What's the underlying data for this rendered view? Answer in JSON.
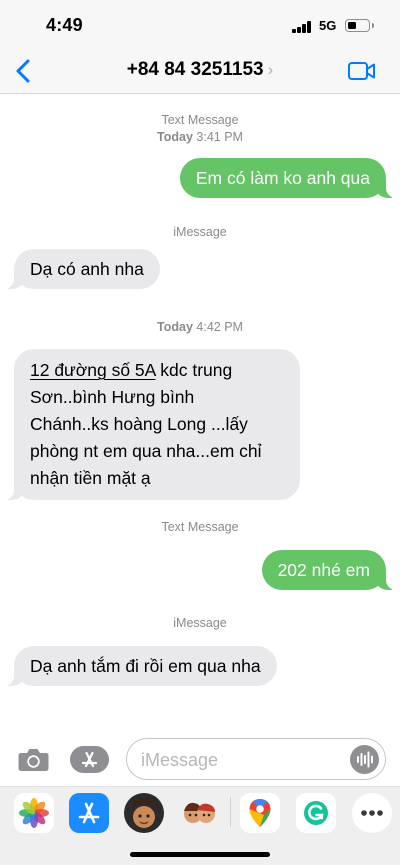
{
  "status_bar": {
    "time": "4:49",
    "network": "5G"
  },
  "header": {
    "contact": "+84 84 3251153",
    "chevron": "›"
  },
  "messages": [
    {
      "type": "meta",
      "service": "Text Message",
      "day": "Today",
      "time": "3:41 PM"
    },
    {
      "type": "outgoing",
      "text": "Em có làm ko anh qua"
    },
    {
      "type": "meta",
      "service": "iMessage"
    },
    {
      "type": "incoming",
      "text": "Dạ có anh nha"
    },
    {
      "type": "meta",
      "day": "Today",
      "time": "4:42 PM"
    },
    {
      "type": "incoming",
      "lines": [
        "12 đường số 5A",
        " kdc trung",
        "Sơn..bình Hưng bình",
        "Chánh..ks hoàng Long ...lấy",
        "phòng nt em qua nha...em chỉ",
        "nhận tiền mặt ạ"
      ]
    },
    {
      "type": "meta",
      "service": "Text Message"
    },
    {
      "type": "outgoing",
      "text": "202 nhé em"
    },
    {
      "type": "meta",
      "service": "iMessage"
    },
    {
      "type": "incoming",
      "text": "Dạ anh tắm đi rồi em qua nha"
    }
  ],
  "input": {
    "placeholder": "iMessage"
  },
  "icons": {
    "back": "back-chevron-icon",
    "video": "video-camera-icon",
    "camera": "camera-icon",
    "apps": "app-store-icon",
    "audio": "audio-waveform-icon"
  },
  "app_drawer": [
    "Photos",
    "App Store",
    "Memoji",
    "Memoji Stickers",
    "Google Maps",
    "Grammarly",
    "More"
  ],
  "colors": {
    "accent": "#007aff",
    "outgoing_bubble": "#65c466",
    "incoming_bubble": "#e9e9eb"
  }
}
